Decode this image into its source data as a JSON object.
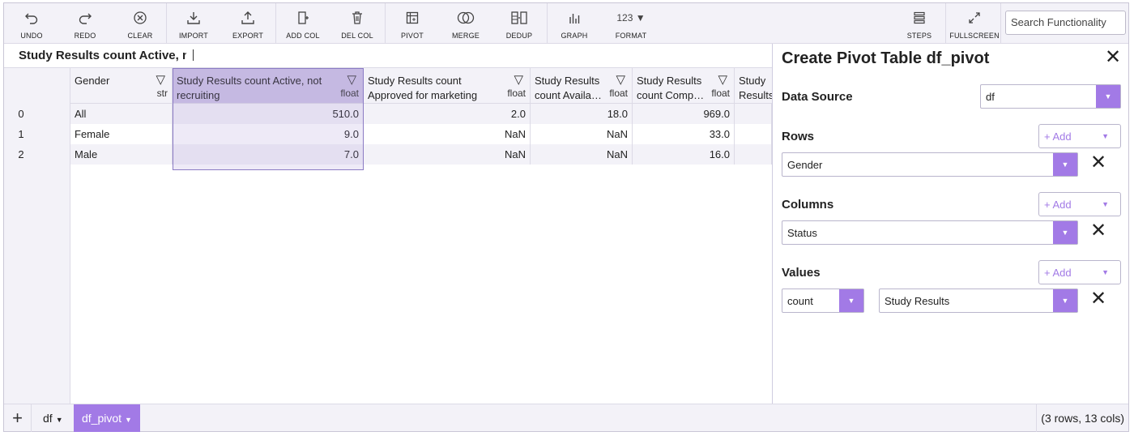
{
  "toolbar": {
    "buttons": [
      {
        "label": "UNDO",
        "icon": "undo-icon"
      },
      {
        "label": "REDO",
        "icon": "redo-icon"
      },
      {
        "label": "CLEAR",
        "icon": "clear-icon"
      },
      {
        "label": "IMPORT",
        "icon": "import-icon"
      },
      {
        "label": "EXPORT",
        "icon": "export-icon"
      },
      {
        "label": "ADD COL",
        "icon": "add-column-icon"
      },
      {
        "label": "DEL COL",
        "icon": "trash-icon"
      },
      {
        "label": "PIVOT",
        "icon": "pivot-icon"
      },
      {
        "label": "MERGE",
        "icon": "merge-icon"
      },
      {
        "label": "DEDUP",
        "icon": "dedup-icon"
      },
      {
        "label": "GRAPH",
        "icon": "graph-icon"
      },
      {
        "label": "FORMAT",
        "icon": "format-icon",
        "icon_text": "123 ▼"
      },
      {
        "label": "STEPS",
        "icon": "steps-icon"
      },
      {
        "label": "FULLSCREEN",
        "icon": "fullscreen-icon"
      }
    ],
    "search_placeholder": "Search Functionality"
  },
  "editbar": {
    "cell_name": "Study Results count Active, not recruiting"
  },
  "table": {
    "columns": [
      {
        "name": "Gender",
        "type": "str"
      },
      {
        "name": "Study Results count Active, not recruiting",
        "type": "float"
      },
      {
        "name": "Study Results count Approved for marketing",
        "type": "float"
      },
      {
        "name": "Study Results count Availa…",
        "type": "float"
      },
      {
        "name": "Study Results count Comp…",
        "type": "float"
      },
      {
        "name": "Study Results count E",
        "type": ""
      }
    ],
    "rows": [
      {
        "index": "0",
        "cells": [
          "All",
          "510.0",
          "2.0",
          "18.0",
          "969.0",
          ""
        ]
      },
      {
        "index": "1",
        "cells": [
          "Female",
          "9.0",
          "NaN",
          "NaN",
          "33.0",
          ""
        ]
      },
      {
        "index": "2",
        "cells": [
          "Male",
          "7.0",
          "NaN",
          "NaN",
          "16.0",
          ""
        ]
      }
    ]
  },
  "panel": {
    "title": "Create Pivot Table df_pivot",
    "data_source_label": "Data Source",
    "data_source_value": "df",
    "rows_label": "Rows",
    "rows_value": "Gender",
    "columns_label": "Columns",
    "columns_value": "Status",
    "values_label": "Values",
    "values_agg": "count",
    "values_field": "Study Results",
    "add_label": "+ Add"
  },
  "bottom": {
    "tabs": [
      "df",
      "df_pivot"
    ],
    "active_tab": "df_pivot",
    "status": "(3 rows, 13 cols)"
  },
  "colors": {
    "accent": "#a27ae6",
    "selection": "#cdc4e6",
    "toolbar_bg": "#f3f2f8"
  }
}
